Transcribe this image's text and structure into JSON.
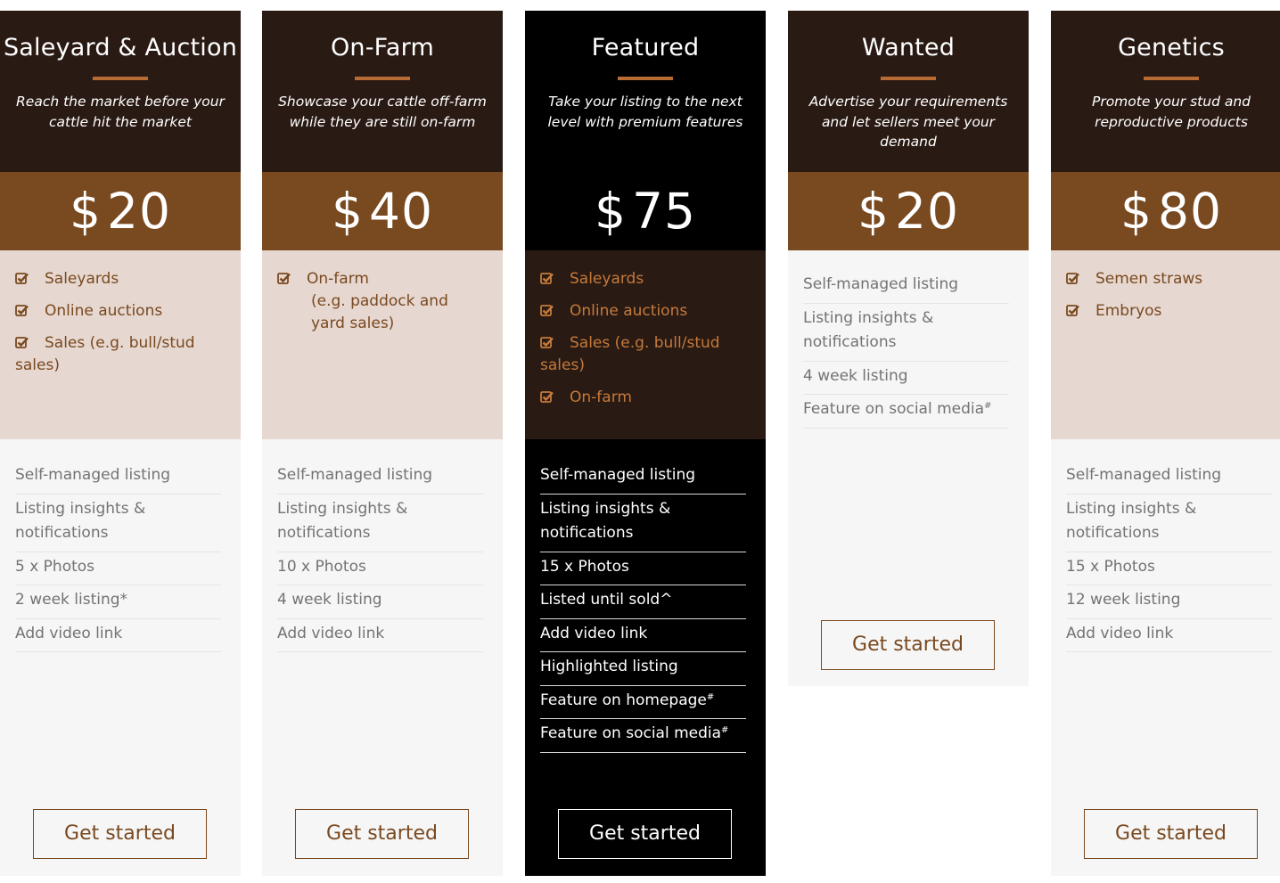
{
  "plans": [
    {
      "title": "Saleyard & Auction",
      "subtitle": "Reach the market before your cattle hit the market",
      "currency": "$",
      "price": "20",
      "checklist": [
        "Saleyards",
        "Online auctions",
        "Sales (e.g. bull/stud sales)"
      ],
      "features": [
        "Self-managed listing",
        "Listing insights & notifications",
        "5 x Photos",
        "2 week listing*",
        "Add video link"
      ],
      "button": "Get started"
    },
    {
      "title": "On-Farm",
      "subtitle": "Showcase your cattle off-farm while they are still on-farm",
      "currency": "$",
      "price": "40",
      "checklist": [
        "On-farm",
        "(e.g. paddock and yard sales)"
      ],
      "features": [
        "Self-managed listing",
        "Listing insights & notifications",
        "10 x Photos",
        "4 week listing",
        "Add video link"
      ],
      "button": "Get started"
    },
    {
      "title": "Featured",
      "subtitle": "Take your listing to the next level with premium features",
      "currency": "$",
      "price": "75",
      "checklist": [
        "Saleyards",
        "Online auctions",
        "Sales (e.g. bull/stud sales)",
        "On-farm"
      ],
      "features": [
        "Self-managed listing",
        "Listing insights & notifications",
        "15 x Photos",
        "Listed until sold^",
        "Add video link",
        "Highlighted listing",
        "Feature on homepage",
        "Feature on social media"
      ],
      "footnote_mark": "#",
      "button": "Get started"
    },
    {
      "title": "Wanted",
      "subtitle": "Advertise your requirements and let sellers meet your demand",
      "currency": "$",
      "price": "20",
      "features": [
        "Self-managed listing",
        "Listing insights & notifications",
        "4 week listing",
        "Feature on social media"
      ],
      "footnote_mark": "#",
      "button": "Get started"
    },
    {
      "title": "Genetics",
      "subtitle": "Promote your stud and reproductive products",
      "currency": "$",
      "price": "80",
      "checklist": [
        "Semen straws",
        "Embryos"
      ],
      "features": [
        "Self-managed listing",
        "Listing insights & notifications",
        "15 x Photos",
        "12 week listing",
        "Add video link"
      ],
      "button": "Get started"
    }
  ],
  "colors": {
    "header_bg": "#2a1a14",
    "price_bg": "#79491f",
    "accent_bar": "#b86b32",
    "checklist_bg": "#e6d7d0",
    "features_bg": "#f6f6f6",
    "featured_bg": "#000000",
    "featured_check": "#c47a3a"
  }
}
